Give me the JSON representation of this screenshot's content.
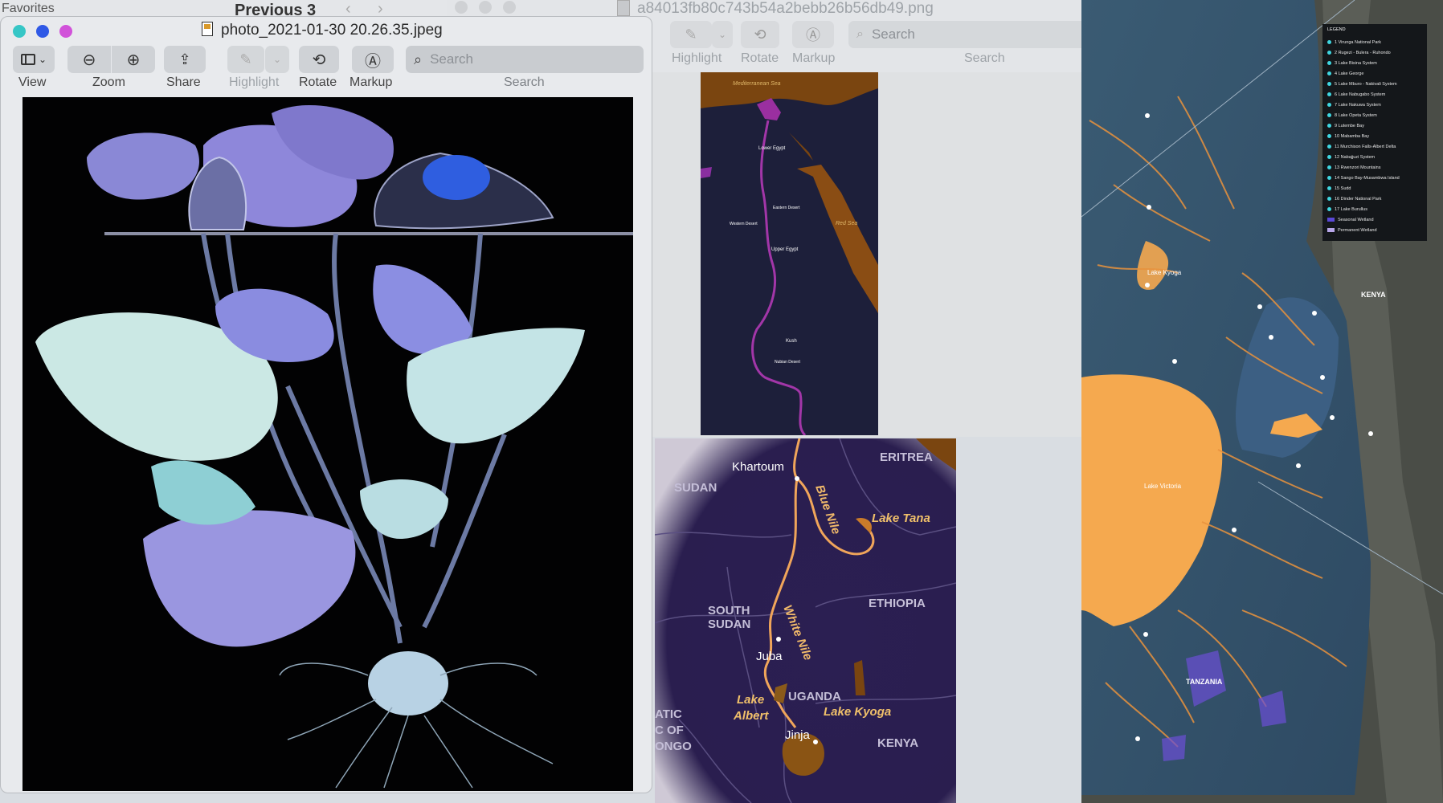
{
  "background": {
    "favorites_label": "Favorites",
    "previous_label": "Previous 3"
  },
  "preview_front": {
    "title": "photo_2021-01-30 20.26.35.jpeg",
    "toolbar": {
      "view": "View",
      "zoom": "Zoom",
      "share": "Share",
      "highlight": "Highlight",
      "rotate": "Rotate",
      "markup": "Markup",
      "search_section": "Search"
    },
    "search_placeholder": "Search"
  },
  "preview_back": {
    "title": "a84013fb80c743b54a2bebb26b56db49.png",
    "toolbar": {
      "highlight": "Highlight",
      "rotate": "Rotate",
      "markup": "Markup",
      "search_section": "Search"
    },
    "search_placeholder": "Search"
  },
  "map_egypt": {
    "sea_north": "Mediterranean Sea",
    "lower_egypt": "Lower Egypt",
    "upper_egypt": "Upper Egypt",
    "eastern_desert": "Eastern Desert",
    "western_desert": "Western Desert",
    "red_sea": "Red Sea",
    "kush": "Kush",
    "nubian_desert": "Nubian Desert"
  },
  "map_nile": {
    "khartoum": "Khartoum",
    "eritrea": "ERITREA",
    "sudan": "SUDAN",
    "blue_nile": "Blue Nile",
    "lake_tana": "Lake Tana",
    "south_sudan_1": "SOUTH",
    "south_sudan_2": "SUDAN",
    "white_nile": "White Nile",
    "ethiopia": "ETHIOPIA",
    "juba": "Juba",
    "lake_albert_1": "Lake",
    "lake_albert_2": "Albert",
    "uganda": "UGANDA",
    "lake_kyoga": "Lake Kyoga",
    "congo_1": "ATIC",
    "congo_2": "C OF",
    "congo_3": "ONGO",
    "jinja": "Jinja",
    "kenya": "KENYA"
  },
  "map_victoria": {
    "kenya": "KENYA",
    "tanzania": "TANZANIA",
    "lake_victoria": "Lake Victoria",
    "lake_kyoga": "Lake Kyoga",
    "legend_title": "LEGEND",
    "legend": [
      "1 Virunga National Park",
      "2 Rugezi - Bulera - Ruhondo",
      "3 Lake Bisina System",
      "4 Lake George",
      "5 Lake Mburo - Nakivali System",
      "6 Lake Nabugabo System",
      "7 Lake Nakuwa System",
      "8 Lake Opeta System",
      "9 Lutembe Bay",
      "10 Mabamba Bay",
      "11 Murchison Falls-Albert Delta",
      "12 Nabajjuzi System",
      "13 Rwenzori Mountains",
      "14 Sango Bay-Musambwa Island",
      "15 Sudd",
      "16 Dinder National Park",
      "17 Lake Burullus",
      "Seasonal Wetland",
      "Permanent Wetland"
    ]
  }
}
